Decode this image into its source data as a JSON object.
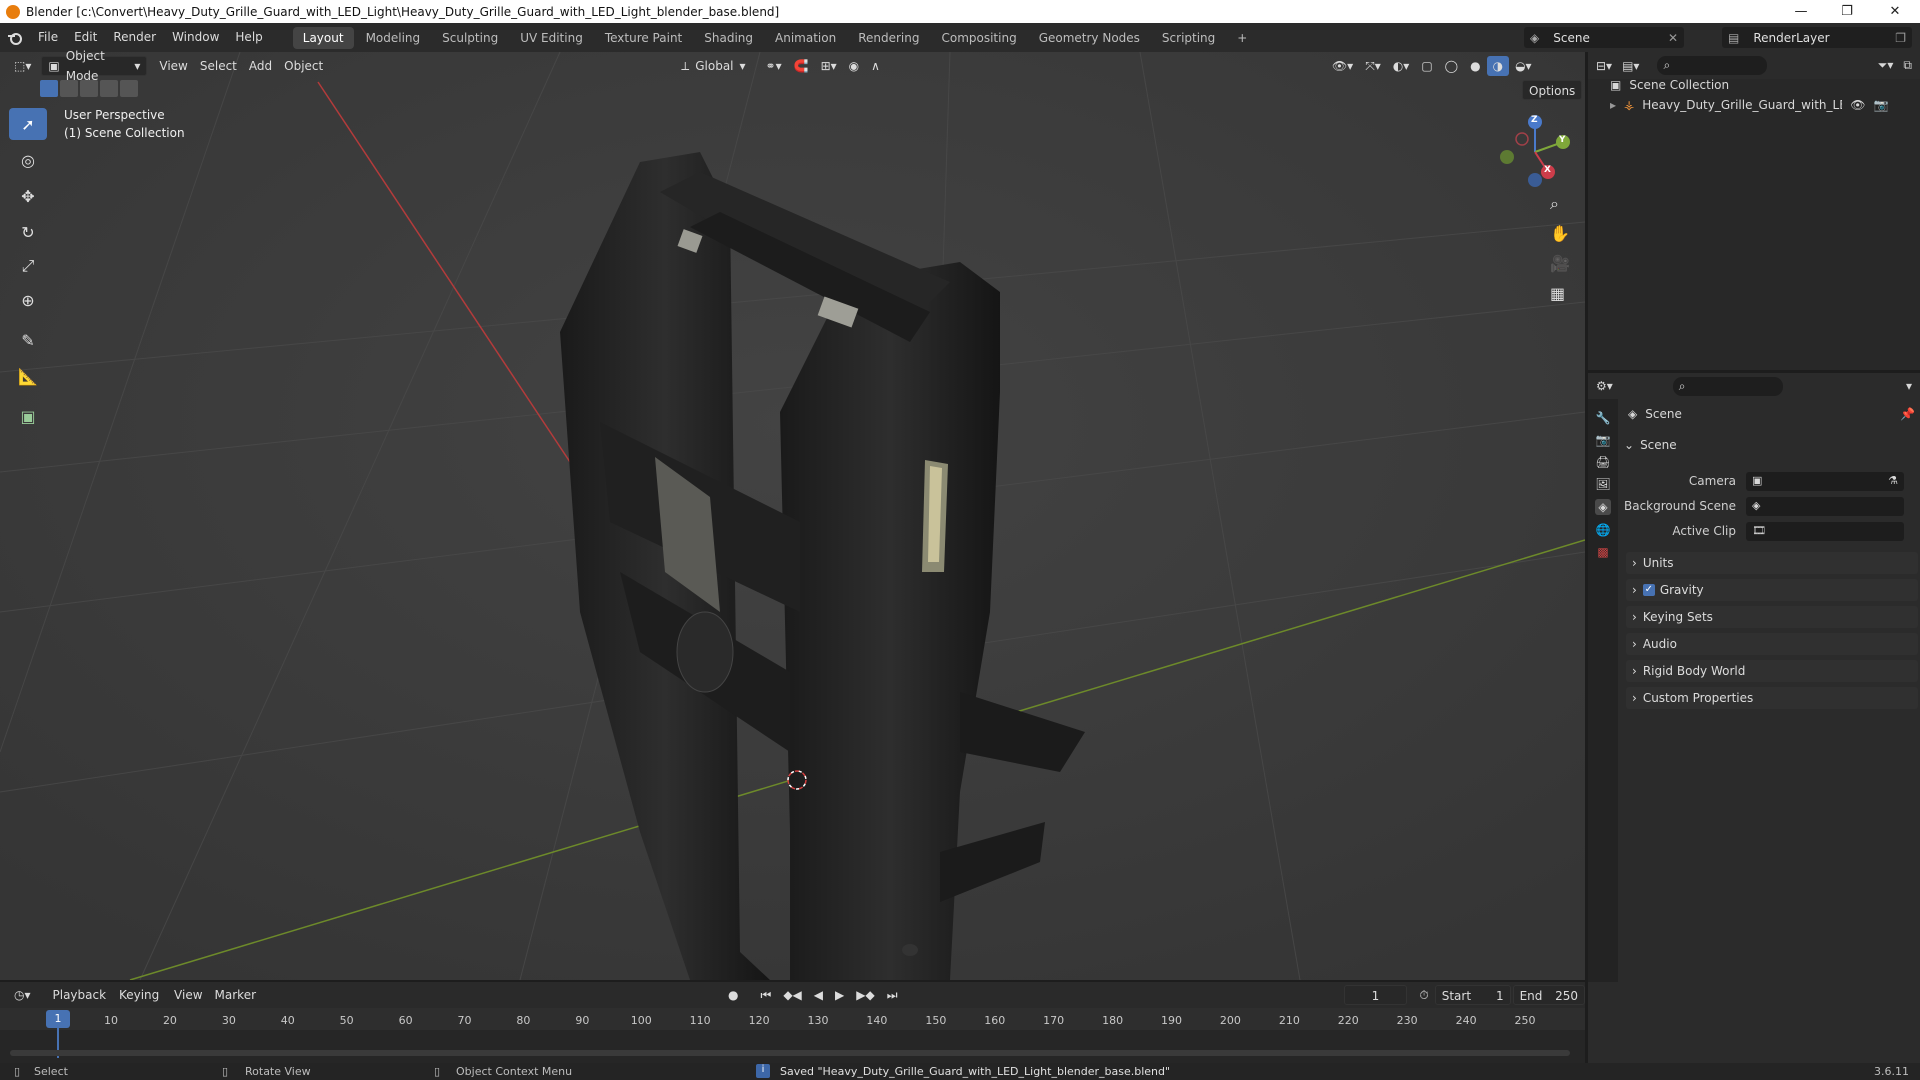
{
  "window": {
    "title": "Blender [c:\\Convert\\Heavy_Duty_Grille_Guard_with_LED_Light\\Heavy_Duty_Grille_Guard_with_LED_Light_blender_base.blend]",
    "minimize": "—",
    "maximize": "❐",
    "close": "✕"
  },
  "menu": [
    "File",
    "Edit",
    "Render",
    "Window",
    "Help"
  ],
  "workspaces": [
    "Layout",
    "Modeling",
    "Sculpting",
    "UV Editing",
    "Texture Paint",
    "Shading",
    "Animation",
    "Rendering",
    "Compositing",
    "Geometry Nodes",
    "Scripting"
  ],
  "add_workspace": "+",
  "scene_selector": "Scene",
  "renderlayer_selector": "RenderLayer",
  "viewport": {
    "mode": "Object Mode",
    "menus": [
      "View",
      "Select",
      "Add",
      "Object"
    ],
    "orientation": "Global",
    "options": "Options",
    "overlay_title": "User Perspective",
    "overlay_subtitle": "(1) Scene Collection",
    "gizmo": {
      "z": "Z",
      "y": "Y",
      "x": "X"
    }
  },
  "outliner": {
    "root": "Scene Collection",
    "object": "Heavy_Duty_Grille_Guard_with_LED_Lig"
  },
  "properties": {
    "header": "Scene",
    "panel": "Scene",
    "fields": {
      "camera": "Camera",
      "background_scene": "Background Scene",
      "active_clip": "Active Clip"
    },
    "sections": [
      "Units",
      "Gravity",
      "Keying Sets",
      "Audio",
      "Rigid Body World",
      "Custom Properties"
    ],
    "gravity_checked": true
  },
  "timeline": {
    "menus": [
      "Playback",
      "Keying",
      "View",
      "Marker"
    ],
    "current_frame": "1",
    "start_label": "Start",
    "start": "1",
    "end_label": "End",
    "end": "250",
    "ticks": [
      "1",
      "10",
      "20",
      "30",
      "40",
      "50",
      "60",
      "70",
      "80",
      "90",
      "100",
      "110",
      "120",
      "130",
      "140",
      "150",
      "160",
      "170",
      "180",
      "190",
      "200",
      "210",
      "220",
      "230",
      "240",
      "250"
    ]
  },
  "statusbar": {
    "select": "Select",
    "rotate": "Rotate View",
    "context": "Object Context Menu",
    "message": "Saved \"Heavy_Duty_Grille_Guard_with_LED_Light_blender_base.blend\"",
    "version": "3.6.11"
  }
}
